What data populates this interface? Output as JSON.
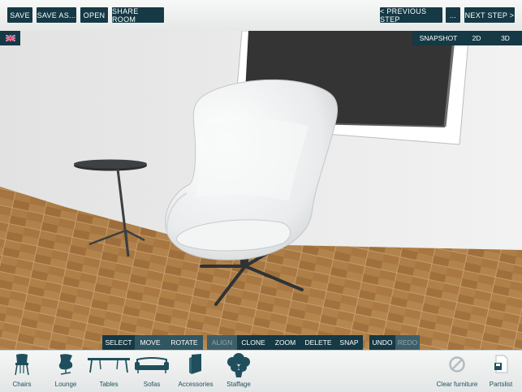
{
  "top_left_buttons": {
    "save": "SAVE",
    "save_as": "SAVE AS...",
    "open": "OPEN",
    "share_room": "SHARE ROOM"
  },
  "top_right_buttons": {
    "previous_step": "< PREVIOUS STEP",
    "more": "...",
    "next_step": "NEXT STEP >"
  },
  "view_modes": {
    "snapshot": "SNAPSHOT",
    "two_d": "2D",
    "three_d": "3D"
  },
  "language_flag": "uk-flag-icon",
  "tools": {
    "select": "SELECT",
    "move": "MOVE",
    "rotate": "ROTATE",
    "align": "ALIGN",
    "clone": "CLONE",
    "zoom": "ZOOM",
    "delete": "DELETE",
    "snap": "SNAP",
    "undo": "UNDO",
    "redo": "REDO"
  },
  "categories": [
    {
      "label": "Chairs",
      "icon": "chair-icon"
    },
    {
      "label": "Lounge",
      "icon": "lounge-chair-icon"
    },
    {
      "label": "Tables",
      "icon": "table-icon"
    },
    {
      "label": "Sofas",
      "icon": "sofa-icon"
    },
    {
      "label": "Accessories",
      "icon": "accessories-icon"
    },
    {
      "label": "Staffage",
      "icon": "plant-icon"
    }
  ],
  "actions": {
    "clear_furniture": "Clear furniture",
    "partslist": "Partslist"
  },
  "colors": {
    "toolbar_bg": "#153945",
    "active_tool_bg": "#2f5661",
    "label_teal": "#1f4f5c",
    "floor": "#a8783f"
  }
}
